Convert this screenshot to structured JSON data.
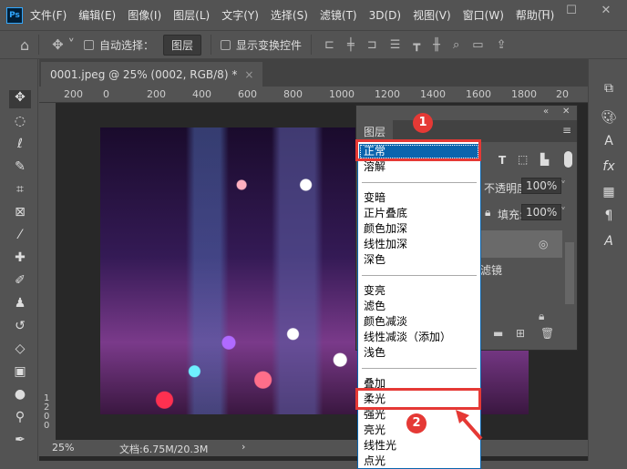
{
  "app": {
    "logo": "Ps"
  },
  "menu": [
    "文件(F)",
    "编辑(E)",
    "图像(I)",
    "图层(L)",
    "文字(Y)",
    "选择(S)",
    "滤镜(T)",
    "3D(D)",
    "视图(V)",
    "窗口(W)",
    "帮助(H)"
  ],
  "window_controls": {
    "minimize": "—",
    "maximize": "☐",
    "close": "✕"
  },
  "options": {
    "auto_select_label": "自动选择：",
    "auto_select_value": "图层",
    "show_transform_label": "显示变换控件"
  },
  "document": {
    "tab_title": "0001.jpeg @ 25% (0002, RGB/8) *",
    "close": "×"
  },
  "ruler": {
    "ticks": [
      "200",
      "0",
      "200",
      "400",
      "600",
      "800",
      "1000",
      "1200",
      "1400",
      "1600",
      "1800",
      "20"
    ],
    "vertical": "1200"
  },
  "status": {
    "zoom": "25%",
    "doc_size": "文档:6.75M/20.3M",
    "arrow": "›"
  },
  "layers_panel": {
    "tab": "图层",
    "opacity_label": "不透明度:",
    "opacity": "100%",
    "fill_label": "填充:",
    "fill": "100%",
    "layer_name_partial": "滤镜"
  },
  "blend_dropdown": {
    "selected": "正常",
    "hover": "柔光",
    "groups": [
      [
        "正常",
        "溶解"
      ],
      [
        "变暗",
        "正片叠底",
        "颜色加深",
        "线性加深",
        "深色"
      ],
      [
        "变亮",
        "滤色",
        "颜色减淡",
        "线性减淡（添加）",
        "浅色"
      ],
      [
        "叠加",
        "柔光",
        "强光",
        "亮光",
        "线性光",
        "点光"
      ]
    ]
  },
  "annotations": {
    "step1": "1",
    "step2": "2",
    "accent": "#e53935"
  }
}
